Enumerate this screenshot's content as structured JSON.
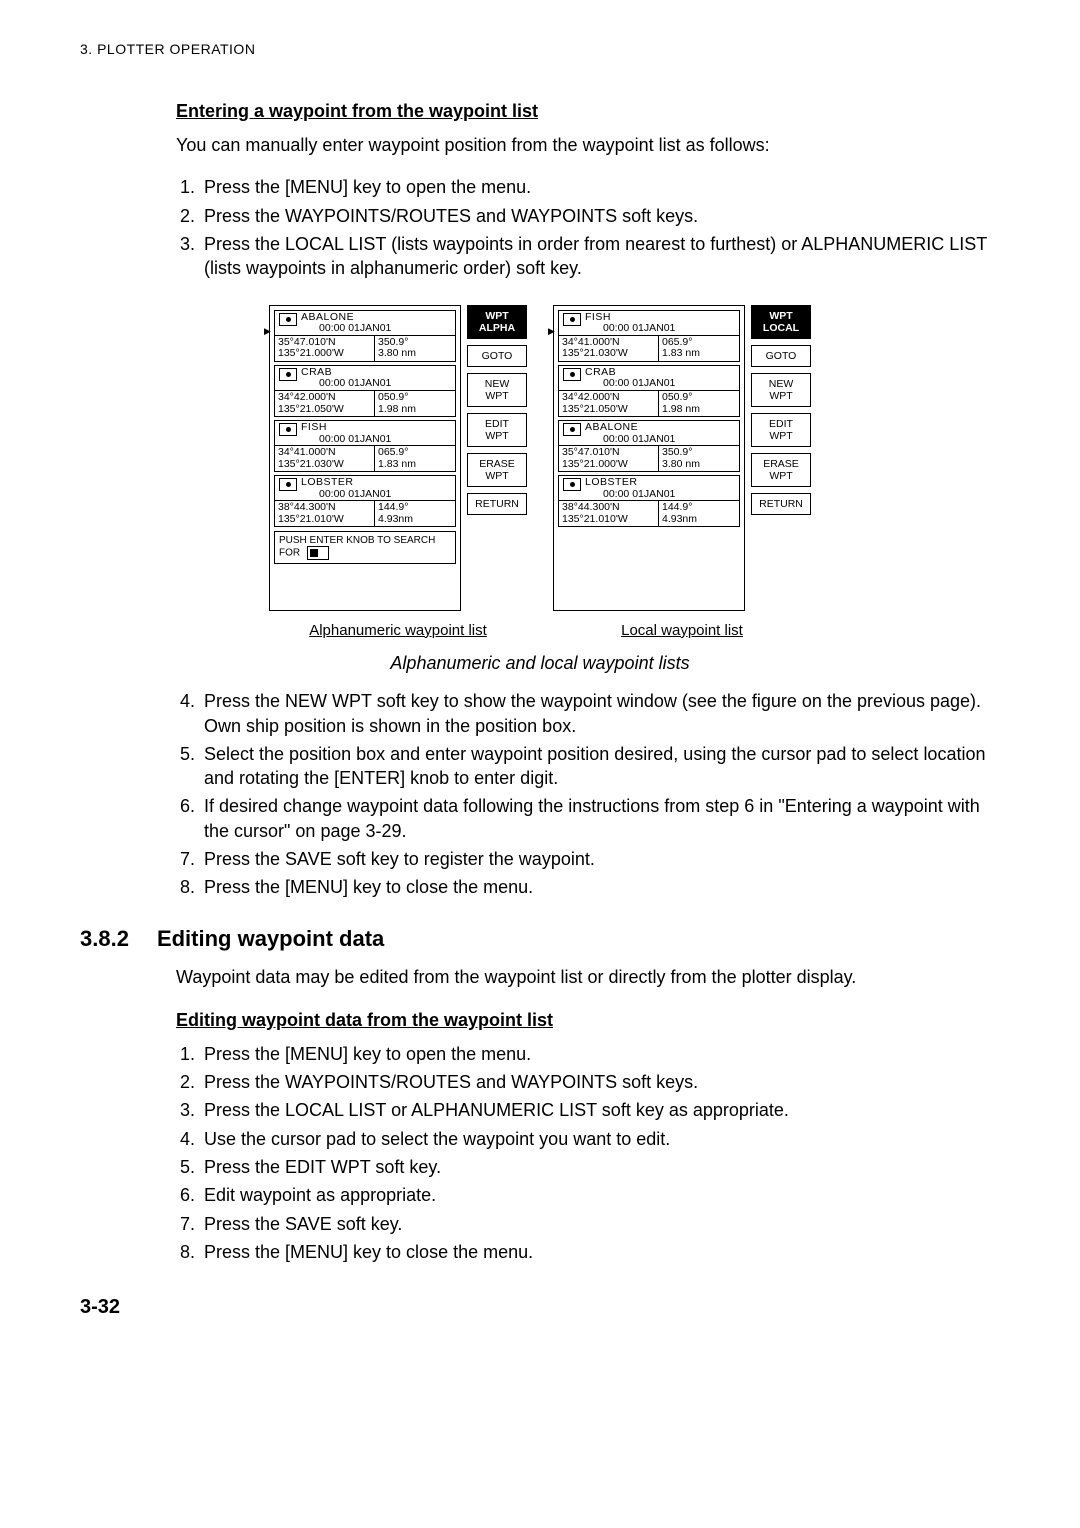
{
  "header": "3. PLOTTER OPERATION",
  "sub1": "Entering a waypoint from the waypoint list",
  "intro": "You can manually enter waypoint position from the waypoint list as follows:",
  "stepsA": [
    "Press the [MENU] key to open the menu.",
    "Press the WAYPOINTS/ROUTES and WAYPOINTS soft keys.",
    "Press the LOCAL LIST (lists waypoints in order from nearest to furthest) or ALPHANUMERIC LIST (lists waypoints in alphanumeric order) soft key."
  ],
  "softLabels": {
    "alpha_hdr": "WPT\nALPHA",
    "local_hdr": "WPT\nLOCAL",
    "goto": "GOTO",
    "newwpt": "NEW\nWPT",
    "editwpt": "EDIT\nWPT",
    "erasewpt": "ERASE\nWPT",
    "ret": "RETURN"
  },
  "left_items": [
    {
      "name": "ABALONE",
      "date": "00:00 01JAN01",
      "lat": "35°47.010'N",
      "lon": "135°21.000'W",
      "brg": "350.9°",
      "rng": "3.80 nm",
      "ptr": true
    },
    {
      "name": "CRAB",
      "date": "00:00 01JAN01",
      "lat": "34°42.000'N",
      "lon": "135°21.050'W",
      "brg": "050.9°",
      "rng": "1.98 nm"
    },
    {
      "name": "FISH",
      "date": "00:00 01JAN01",
      "lat": "34°41.000'N",
      "lon": "135°21.030'W",
      "brg": "065.9°",
      "rng": "1.83 nm"
    },
    {
      "name": "LOBSTER",
      "date": "00:00 01JAN01",
      "lat": "38°44.300'N",
      "lon": "135°21.010'W",
      "brg": "144.9°",
      "rng": "4.93nm"
    }
  ],
  "search_text": "PUSH ENTER KNOB TO SEARCH FOR",
  "right_items": [
    {
      "name": "FISH",
      "date": "00:00 01JAN01",
      "lat": "34°41.000'N",
      "lon": "135°21.030'W",
      "brg": "065.9°",
      "rng": "1.83 nm",
      "ptr": true
    },
    {
      "name": "CRAB",
      "date": "00:00 01JAN01",
      "lat": "34°42.000'N",
      "lon": "135°21.050'W",
      "brg": "050.9°",
      "rng": "1.98 nm"
    },
    {
      "name": "ABALONE",
      "date": "00:00 01JAN01",
      "lat": "35°47.010'N",
      "lon": "135°21.000'W",
      "brg": "350.9°",
      "rng": "3.80 nm"
    },
    {
      "name": "LOBSTER",
      "date": "00:00 01JAN01",
      "lat": "38°44.300'N",
      "lon": "135°21.010'W",
      "brg": "144.9°",
      "rng": "4.93nm"
    }
  ],
  "cap_left": "Alphanumeric waypoint list",
  "cap_right": "Local waypoint list",
  "figmain": "Alphanumeric and local waypoint lists",
  "stepsB": [
    "Press the NEW WPT soft key to show the waypoint window (see the figure on the previous page). Own ship position is shown in the position box.",
    "Select the position box and enter waypoint position desired, using the cursor pad to select location and rotating the [ENTER] knob to enter digit.",
    "If desired change waypoint data following the instructions from step 6 in \"Entering a waypoint with the cursor\" on page 3-29.",
    "Press the SAVE soft key to register the waypoint.",
    "Press the [MENU] key to close the menu."
  ],
  "sec_num": "3.8.2",
  "sec_title": "Editing waypoint data",
  "sec_intro": "Waypoint data may be edited from the waypoint list or directly from the plotter display.",
  "sub2": "Editing waypoint data from the waypoint list",
  "stepsC": [
    "Press the [MENU] key to open the menu.",
    "Press the WAYPOINTS/ROUTES and WAYPOINTS soft keys.",
    "Press the LOCAL LIST or ALPHANUMERIC LIST soft key as appropriate.",
    "Use the cursor pad to select the waypoint you want to edit.",
    "Press the EDIT WPT soft key.",
    "Edit waypoint as appropriate.",
    "Press the SAVE soft key.",
    "Press the [MENU] key to close the menu."
  ],
  "pagenum": "3-32"
}
